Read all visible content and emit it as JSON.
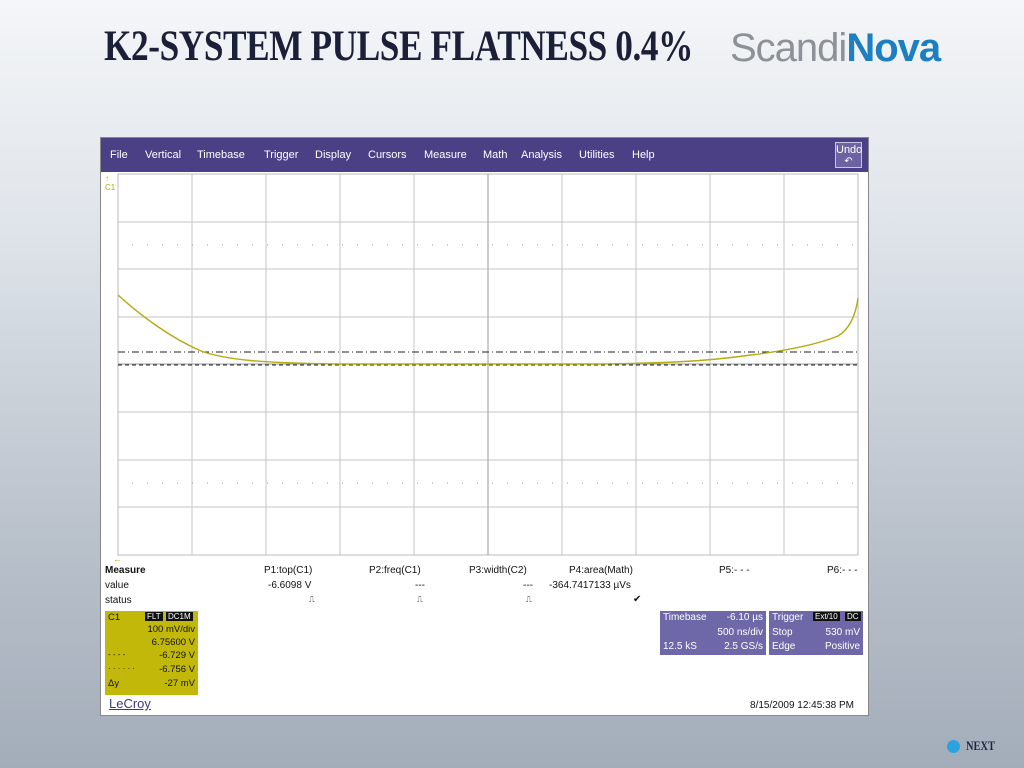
{
  "slide": {
    "title": "K2-SYSTEM PULSE FLATNESS 0.4%",
    "logo_part1": "Scandi",
    "logo_part2": "Nova",
    "next_label": "NEXT"
  },
  "menu": [
    "File",
    "Vertical",
    "Timebase",
    "Trigger",
    "Display",
    "Cursors",
    "Measure",
    "Math",
    "Analysis",
    "Utilities",
    "Help"
  ],
  "undo_label": "Undo",
  "channel_marker": "C1",
  "measure": {
    "row_labels": [
      "Measure",
      "value",
      "status"
    ],
    "columns": [
      {
        "name": "P1:top(C1)",
        "value": "-6.6098 V",
        "status": "⎍"
      },
      {
        "name": "P2:freq(C1)",
        "value": "---",
        "status": "⎍"
      },
      {
        "name": "P3:width(C2)",
        "value": "---",
        "status": "⎍"
      },
      {
        "name": "P4:area(Math)",
        "value": "-364.7417133 µVs",
        "status": "✔"
      },
      {
        "name": "P5:- - -",
        "value": "",
        "status": ""
      },
      {
        "name": "P6:- - -",
        "value": "",
        "status": ""
      }
    ]
  },
  "channel": {
    "name": "C1",
    "tag1": "FLT",
    "tag2": "DC1M",
    "volts_div": "100 mV/div",
    "offset": "6.75600 V",
    "cursor1_symbol": "- - - -",
    "cursor1": "-6.729 V",
    "cursor2_symbol": "· · · · · ·",
    "cursor2": "-6.756 V",
    "delta_symbol": "Δy",
    "delta": "-27 mV"
  },
  "timebase": {
    "label": "Timebase",
    "delay": "-6.10 µs",
    "per_div": "500 ns/div",
    "samples": "12.5 kS",
    "rate": "2.5 GS/s"
  },
  "trigger": {
    "label": "Trigger",
    "tag1": "Ext/10",
    "tag2": "DC",
    "mode": "Stop",
    "level": "530 mV",
    "type": "Edge",
    "slope": "Positive"
  },
  "brand": "LeCroy",
  "timestamp": "8/15/2009 12:45:38 PM",
  "colors": {
    "menu_bg": "#4b3f86",
    "trace": "#b5ab10",
    "channel_box": "#c1b80a",
    "info_box": "#6e68a8"
  }
}
